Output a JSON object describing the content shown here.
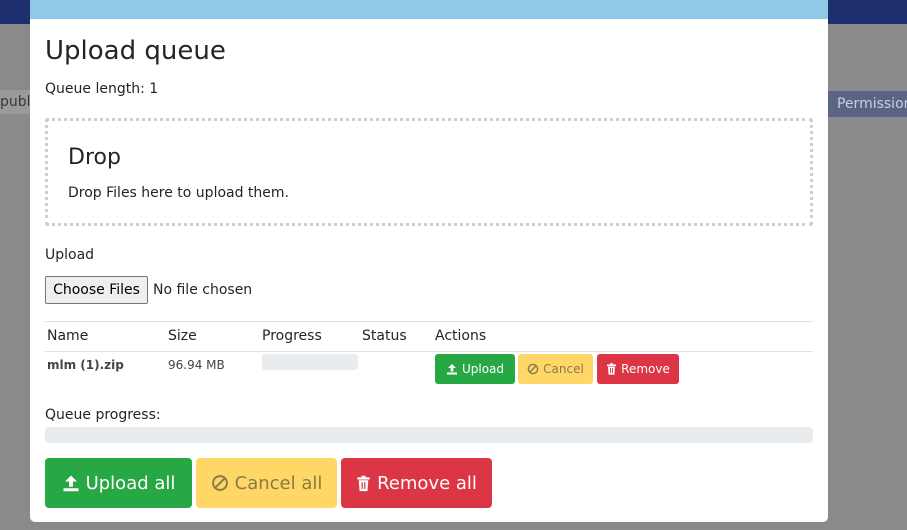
{
  "background": {
    "left_tab_text": "publ",
    "right_tab_text": "Permission"
  },
  "modal": {
    "title": "Upload queue",
    "queue_length": "Queue length: 1",
    "dropzone": {
      "title": "Drop",
      "text": "Drop Files here to upload them."
    },
    "upload_label": "Upload",
    "file_input": {
      "button_label": "Choose Files",
      "status": "No file chosen"
    },
    "table": {
      "headers": [
        "Name",
        "Size",
        "Progress",
        "Status",
        "Actions"
      ],
      "rows": [
        {
          "name": "mlm (1).zip",
          "size": "96.94 MB",
          "progress": 0,
          "status": "",
          "actions": {
            "upload": "Upload",
            "cancel": "Cancel",
            "remove": "Remove"
          }
        }
      ]
    },
    "queue_progress_label": "Queue progress:",
    "queue_progress": 0,
    "footer_buttons": {
      "upload_all": "Upload all",
      "cancel_all": "Cancel all",
      "remove_all": "Remove all"
    }
  },
  "colors": {
    "success": "#28a745",
    "warning": "#ffd766",
    "danger": "#dc3545",
    "header_strip": "#8fc9e8",
    "progress_track": "#e9ecef"
  },
  "icons": [
    "upload-icon",
    "ban-icon",
    "trash-icon"
  ]
}
